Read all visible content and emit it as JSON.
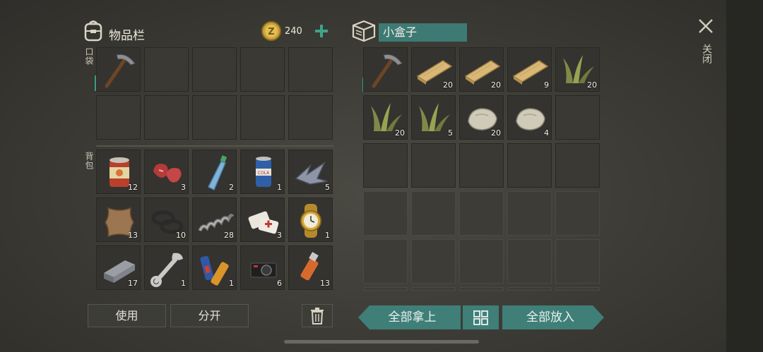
{
  "inventory": {
    "title": "物品栏",
    "coins": "240",
    "pocket_label": "口袋",
    "backpack_label": "背包",
    "pocket_items": [
      {
        "icon": "pickaxe-icon",
        "qty": ""
      }
    ],
    "backpack_items": [
      {
        "icon": "canned-food-icon",
        "qty": "12"
      },
      {
        "icon": "raw-meat-icon",
        "qty": "3"
      },
      {
        "icon": "water-bottle-icon",
        "qty": "2"
      },
      {
        "icon": "soda-can-icon",
        "qty": "1"
      },
      {
        "icon": "scrap-metal-icon",
        "qty": "5"
      },
      {
        "icon": "animal-hide-icon",
        "qty": "13"
      },
      {
        "icon": "rubber-ring-icon",
        "qty": "10"
      },
      {
        "icon": "spring-icon",
        "qty": "28"
      },
      {
        "icon": "bandage-icon",
        "qty": "3"
      },
      {
        "icon": "gold-watch-icon",
        "qty": "1"
      },
      {
        "icon": "iron-bar-icon",
        "qty": "17"
      },
      {
        "icon": "wrench-icon",
        "qty": "1"
      },
      {
        "icon": "batteries-icon",
        "qty": "1"
      },
      {
        "icon": "camera-icon",
        "qty": "6"
      },
      {
        "icon": "usb-drive-icon",
        "qty": "13"
      }
    ],
    "use_label": "使用",
    "split_label": "分开"
  },
  "container": {
    "title": "小盒子",
    "items": [
      {
        "icon": "pickaxe-icon",
        "qty": ""
      },
      {
        "icon": "wood-plank-icon",
        "qty": "20"
      },
      {
        "icon": "wood-plank-icon",
        "qty": "20"
      },
      {
        "icon": "wood-plank-icon",
        "qty": "9"
      },
      {
        "icon": "plant-fiber-icon",
        "qty": "20"
      },
      {
        "icon": "plant-fiber-icon",
        "qty": "20"
      },
      {
        "icon": "plant-fiber-icon",
        "qty": "5"
      },
      {
        "icon": "stone-icon",
        "qty": "20"
      },
      {
        "icon": "stone-icon",
        "qty": "4"
      }
    ],
    "take_all_label": "全部拿上",
    "put_all_label": "全部放入"
  },
  "close_label": "关闭",
  "colors": {
    "accent": "#3f7f78",
    "panel": "#34332f",
    "background": "#3e3d37"
  }
}
